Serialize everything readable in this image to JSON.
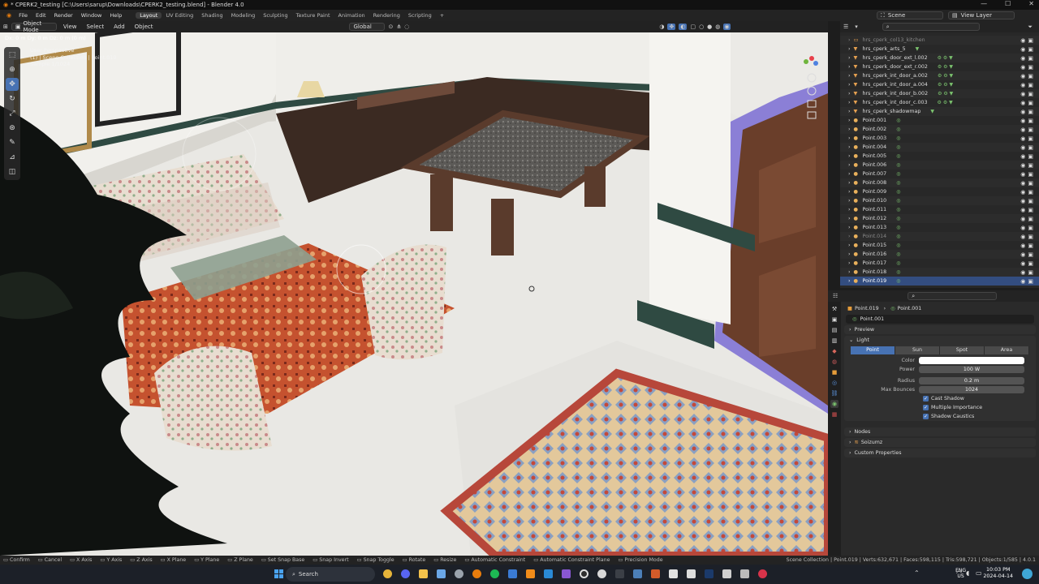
{
  "window": {
    "title": "* CPERK2_testing [C:\\Users\\sarup\\Downloads\\CPERK2_testing.blend] - Blender 4.0"
  },
  "menubar": {
    "menus": [
      "File",
      "Edit",
      "Render",
      "Window",
      "Help"
    ],
    "workspaces": [
      "Layout",
      "UV Editing",
      "Shading",
      "Modeling",
      "Sculpting",
      "Texture Paint",
      "Animation",
      "Rendering",
      "Scripting"
    ],
    "active_workspace": "Layout",
    "scene": "Scene",
    "view_layer": "View Layer"
  },
  "viewport_header": {
    "mode": "Object Mode",
    "menus": [
      "View",
      "Select",
      "Add",
      "Object"
    ],
    "orientation": "Global"
  },
  "operator_info": "Dx: 0 m Dy: 0 m Dz: 0 m (0 m)",
  "overlay": {
    "line1": "User Perspective",
    "line2": "(1) | Scene Collection | Point.019",
    "line3": "Sample 1/1024"
  },
  "outliner": {
    "rows": [
      {
        "name": "hrs_cperk_col13_kitchen",
        "icon": "collection",
        "dim": true,
        "mods": ""
      },
      {
        "name": "hrs_cperk_arts_5",
        "icon": "object",
        "dim": false,
        "mods": "▼"
      },
      {
        "name": "hrs_cperk_door_ext_l.002",
        "icon": "object",
        "dim": false,
        "mods": "⚙ ⚙ ▼"
      },
      {
        "name": "hrs_cperk_door_ext_r.002",
        "icon": "object",
        "dim": false,
        "mods": "⚙ ⚙ ▼"
      },
      {
        "name": "hrs_cperk_int_door_a.002",
        "icon": "object",
        "dim": false,
        "mods": "⚙ ⚙ ▼"
      },
      {
        "name": "hrs_cperk_int_door_a.004",
        "icon": "object",
        "dim": false,
        "mods": "⚙ ⚙ ▼"
      },
      {
        "name": "hrs_cperk_int_door_b.002",
        "icon": "object",
        "dim": false,
        "mods": "⚙ ⚙ ▼"
      },
      {
        "name": "hrs_cperk_int_door_c.003",
        "icon": "object",
        "dim": false,
        "mods": "⚙ ⚙ ▼"
      },
      {
        "name": "hrs_cperk_shadowmap",
        "icon": "object",
        "dim": false,
        "mods": "▼"
      },
      {
        "name": "Point.001",
        "icon": "light",
        "dim": false,
        "mods": "◎"
      },
      {
        "name": "Point.002",
        "icon": "light",
        "dim": false,
        "mods": "◎"
      },
      {
        "name": "Point.003",
        "icon": "light",
        "dim": false,
        "mods": "◎"
      },
      {
        "name": "Point.004",
        "icon": "light",
        "dim": false,
        "mods": "◎"
      },
      {
        "name": "Point.005",
        "icon": "light",
        "dim": false,
        "mods": "◎"
      },
      {
        "name": "Point.006",
        "icon": "light",
        "dim": false,
        "mods": "◎"
      },
      {
        "name": "Point.007",
        "icon": "light",
        "dim": false,
        "mods": "◎"
      },
      {
        "name": "Point.008",
        "icon": "light",
        "dim": false,
        "mods": "◎"
      },
      {
        "name": "Point.009",
        "icon": "light",
        "dim": false,
        "mods": "◎"
      },
      {
        "name": "Point.010",
        "icon": "light",
        "dim": false,
        "mods": "◎"
      },
      {
        "name": "Point.011",
        "icon": "light",
        "dim": false,
        "mods": "◎"
      },
      {
        "name": "Point.012",
        "icon": "light",
        "dim": false,
        "mods": "◎"
      },
      {
        "name": "Point.013",
        "icon": "light",
        "dim": false,
        "mods": "◎"
      },
      {
        "name": "Point.014",
        "icon": "light",
        "dim": true,
        "mods": "◎"
      },
      {
        "name": "Point.015",
        "icon": "light",
        "dim": false,
        "mods": "◎"
      },
      {
        "name": "Point.016",
        "icon": "light",
        "dim": false,
        "mods": "◎"
      },
      {
        "name": "Point.017",
        "icon": "light",
        "dim": false,
        "mods": "◎"
      },
      {
        "name": "Point.018",
        "icon": "light",
        "dim": false,
        "mods": "◎"
      },
      {
        "name": "Point.019",
        "icon": "light",
        "dim": false,
        "mods": "◎",
        "selected": true
      }
    ]
  },
  "properties": {
    "breadcrumb_object": "Point.019",
    "breadcrumb_data": "Point.001",
    "datablock": "Point.001",
    "panels": {
      "preview": "Preview",
      "light": "Light",
      "nodes": "Nodes",
      "soizumz": "Soizumz",
      "custom": "Custom Properties"
    },
    "light_types": [
      "Point",
      "Sun",
      "Spot",
      "Area"
    ],
    "active_light_type": "Point",
    "fields": [
      {
        "label": "Color",
        "value": ""
      },
      {
        "label": "Power",
        "value": "100 W"
      },
      {
        "label": "Radius",
        "value": "0.2 m"
      },
      {
        "label": "Max Bounces",
        "value": "1024"
      }
    ],
    "checkboxes": [
      "Cast Shadow",
      "Multiple Importance",
      "Shadow Caustics"
    ]
  },
  "statusbar": {
    "items": [
      "Confirm",
      "Cancel",
      "X Axis",
      "Y Axis",
      "Z Axis",
      "X Plane",
      "Y Plane",
      "Z Plane",
      "Set Snap Base",
      "Snap Invert",
      "Snap Toggle",
      "Rotate",
      "Resize",
      "Automatic Constraint",
      "Automatic Constraint Plane",
      "Precision Mode"
    ],
    "stats": "Scene Collection | Point.019 | Verts:632,671 | Faces:598,115 | Tris:598,721 | Objects:1/585 | 4.0.1"
  },
  "taskbar": {
    "search_placeholder": "Search",
    "lang_line1": "ENG",
    "lang_line2": "US",
    "time": "10:03 PM",
    "date": "2024-04-14"
  },
  "colors": {
    "accent": "#4772b3",
    "selected_row": "#334d80",
    "light_icon": "#e9b05b",
    "modifier_icon": "#7cc46f"
  }
}
